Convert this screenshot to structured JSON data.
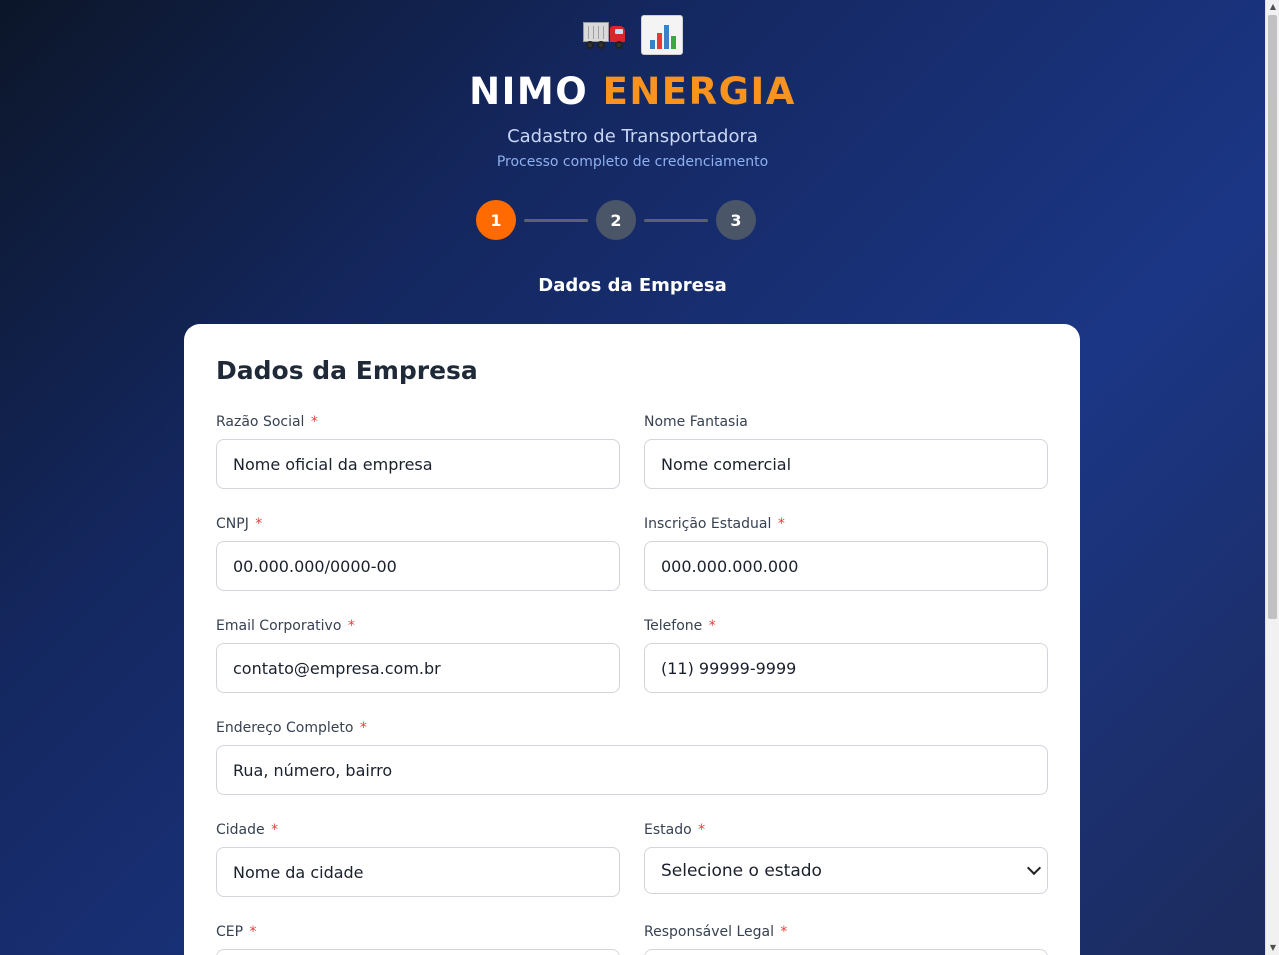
{
  "header": {
    "icons": [
      "truck-icon",
      "bar-chart-icon"
    ],
    "brand_primary": "NIMO",
    "brand_accent": "ENERGIA",
    "subtitle": "Cadastro de Transportadora",
    "tagline": "Processo completo de credenciamento"
  },
  "steps": [
    {
      "number": "1",
      "active": true
    },
    {
      "number": "2",
      "active": false
    },
    {
      "number": "3",
      "active": false
    }
  ],
  "step_title": "Dados da Empresa",
  "form": {
    "title": "Dados da Empresa",
    "required_mark": "*",
    "fields": {
      "razao_social": {
        "label": "Razão Social",
        "placeholder": "Nome oficial da empresa",
        "required": true
      },
      "nome_fantasia": {
        "label": "Nome Fantasia",
        "placeholder": "Nome comercial",
        "required": false
      },
      "cnpj": {
        "label": "CNPJ",
        "placeholder": "00.000.000/0000-00",
        "required": true
      },
      "inscricao_estadual": {
        "label": "Inscrição Estadual",
        "placeholder": "000.000.000.000",
        "required": true
      },
      "email": {
        "label": "Email Corporativo",
        "placeholder": "contato@empresa.com.br",
        "required": true
      },
      "telefone": {
        "label": "Telefone",
        "placeholder": "(11) 99999-9999",
        "required": true
      },
      "endereco": {
        "label": "Endereço Completo",
        "placeholder": "Rua, número, bairro",
        "required": true
      },
      "cidade": {
        "label": "Cidade",
        "placeholder": "Nome da cidade",
        "required": true
      },
      "estado": {
        "label": "Estado",
        "selected": "Selecione o estado",
        "required": true
      },
      "cep": {
        "label": "CEP",
        "required": true
      },
      "responsavel": {
        "label": "Responsável Legal",
        "required": true
      }
    }
  },
  "colors": {
    "accent": "#ff6b00",
    "brand_accent": "#f7931e",
    "required": "#e53e3e",
    "step_inactive": "#4a5568"
  }
}
